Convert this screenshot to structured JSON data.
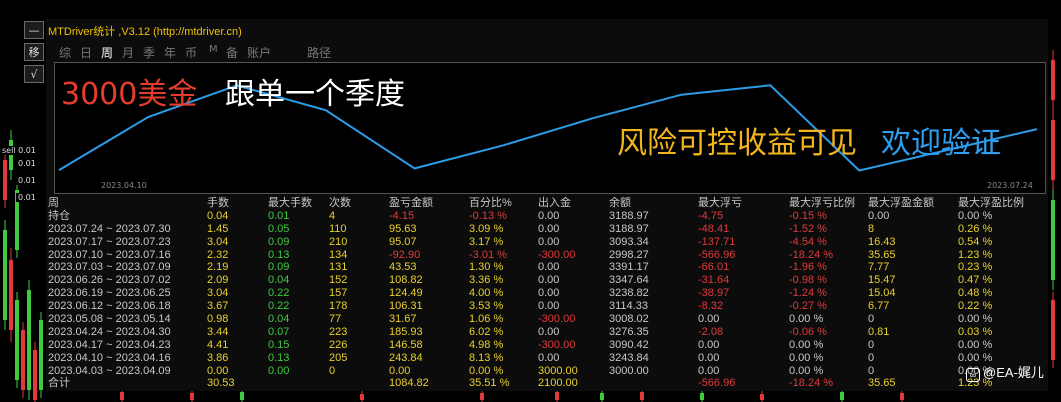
{
  "app": {
    "title": "MTDriver统计 ,V3.12 (http://mtdriver.cn)",
    "tabs": [
      "综",
      "日",
      "周",
      "月",
      "季",
      "年",
      "币",
      "M",
      "备",
      "账户",
      "路径"
    ],
    "active_tab": "周",
    "left_buttons": [
      "—",
      "移",
      "√"
    ]
  },
  "side_labels": {
    "sell_label": "sell 0.01",
    "value_1": "0.01",
    "value_2": "0.01",
    "value_3": "0.01"
  },
  "overlay": {
    "headline_red": "3000美金",
    "headline_white": "跟单一个季度",
    "slogan_yellow": "风险可控收益可见",
    "slogan_blue": "欢迎验证"
  },
  "equity_chart": {
    "start_date": "2023.04.10",
    "end_date": "2023.07.24",
    "line_color": "#2d9ce6",
    "points": [
      3000,
      3243.84,
      3390.42,
      3276.35,
      3008.02,
      3114.33,
      3238.82,
      3347.64,
      3391.17,
      2998.27,
      3093.34,
      3188.97
    ]
  },
  "stats": {
    "headers": [
      "周",
      "手数",
      "最大手数",
      "次数",
      "盈亏金额",
      "百分比%",
      "出入金",
      "余额",
      "最大浮亏",
      "最大浮亏比例",
      "最大浮盈金额",
      "最大浮盈比例"
    ],
    "holdings": [
      "持仓",
      "0.04",
      "0.01",
      "4",
      "-4.15",
      "-0.13 %",
      "0.00",
      "3188.97",
      "-4.75",
      "-0.15 %",
      "0.00",
      "0.00 %"
    ],
    "rows": [
      [
        "2023.07.24 ~ 2023.07.30",
        "1.45",
        "0.05",
        "110",
        "95.63",
        "3.09 %",
        "0.00",
        "3188.97",
        "-48.41",
        "-1.52 %",
        "8",
        "0.26 %"
      ],
      [
        "2023.07.17 ~ 2023.07.23",
        "3.04",
        "0.09",
        "210",
        "95.07",
        "3.17 %",
        "0.00",
        "3093.34",
        "-137.71",
        "-4.54 %",
        "16.43",
        "0.54 %"
      ],
      [
        "2023.07.10 ~ 2023.07.16",
        "2.32",
        "0.13",
        "134",
        "-92.90",
        "-3.01 %",
        "-300.00",
        "2998.27",
        "-566.96",
        "-18.24 %",
        "35.65",
        "1.23 %"
      ],
      [
        "2023.07.03 ~ 2023.07.09",
        "2.19",
        "0.09",
        "131",
        "43.53",
        "1.30 %",
        "0.00",
        "3391.17",
        "-66.01",
        "-1.96 %",
        "7.77",
        "0.23 %"
      ],
      [
        "2023.06.26 ~ 2023.07.02",
        "2.09",
        "0.04",
        "152",
        "108.82",
        "3.36 %",
        "0.00",
        "3347.64",
        "-31.64",
        "-0.98 %",
        "15.47",
        "0.47 %"
      ],
      [
        "2023.06.19 ~ 2023.06.25",
        "3.04",
        "0.22",
        "157",
        "124.49",
        "4.00 %",
        "0.00",
        "3238.82",
        "-38.97",
        "-1.24 %",
        "15.04",
        "0.48 %"
      ],
      [
        "2023.06.12 ~ 2023.06.18",
        "3.67",
        "0.22",
        "178",
        "106.31",
        "3.53 %",
        "0.00",
        "3114.33",
        "-8.32",
        "-0.27 %",
        "6.77",
        "0.22 %"
      ],
      [
        "2023.05.08 ~ 2023.05.14",
        "0.98",
        "0.04",
        "77",
        "31.67",
        "1.06 %",
        "-300.00",
        "3008.02",
        "0.00",
        "0.00 %",
        "0",
        "0.00 %"
      ],
      [
        "2023.04.24 ~ 2023.04.30",
        "3.44",
        "0.07",
        "223",
        "185.93",
        "6.02 %",
        "0.00",
        "3276.35",
        "-2.08",
        "-0.06 %",
        "0.81",
        "0.03 %"
      ],
      [
        "2023.04.17 ~ 2023.04.23",
        "4.41",
        "0.15",
        "226",
        "146.58",
        "4.98 %",
        "-300.00",
        "3090.42",
        "0.00",
        "0.00 %",
        "0",
        "0.00 %"
      ],
      [
        "2023.04.10 ~ 2023.04.16",
        "3.86",
        "0.13",
        "205",
        "243.84",
        "8.13 %",
        "0.00",
        "3243.84",
        "0.00",
        "0.00 %",
        "0",
        "0.00 %"
      ],
      [
        "2023.04.03 ~ 2023.04.09",
        "0.00",
        "0.00",
        "0",
        "0.00",
        "0.00 %",
        "3000.00",
        "3000.00",
        "0.00",
        "0.00 %",
        "0",
        "0.00 %"
      ]
    ],
    "totals": [
      "合计",
      "30.53",
      "",
      "",
      "1084.82",
      "35.51 %",
      "2100.00",
      "",
      "-566.96",
      "-18.24 %",
      "35.65",
      "1.23 %"
    ]
  },
  "watermark": {
    "icon": "wechat-channels-icon",
    "text": "@EA-娓儿"
  },
  "colors": {
    "title": "#f0c000",
    "positive": "#3ecb3e",
    "negative": "#e03a3a",
    "value": "#e8d030",
    "label": "#c8c8c8",
    "headline_red": "#e43d2e",
    "slogan_yellow": "#f2b51c",
    "slogan_blue": "#2e9ef0"
  }
}
